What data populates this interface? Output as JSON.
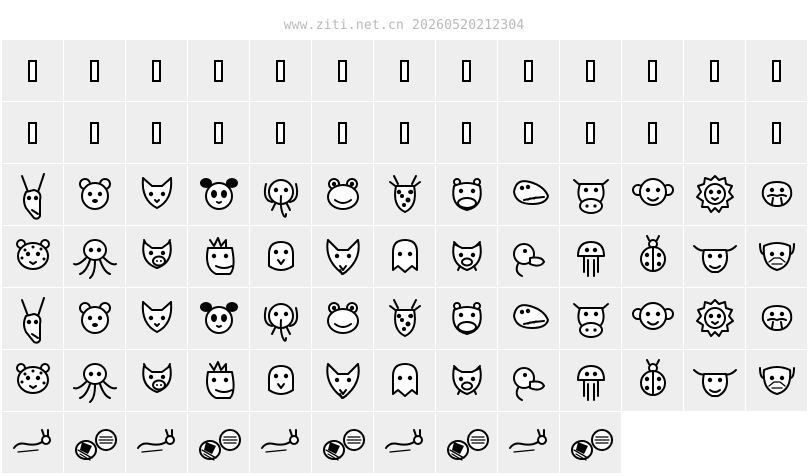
{
  "watermark": "www.ziti.net.cn 20260520212304",
  "rows": [
    [
      "tofu",
      "tofu",
      "tofu",
      "tofu",
      "tofu",
      "tofu",
      "tofu",
      "tofu",
      "tofu",
      "tofu",
      "tofu",
      "tofu",
      "tofu"
    ],
    [
      "tofu",
      "tofu",
      "tofu",
      "tofu",
      "tofu",
      "tofu",
      "tofu",
      "tofu",
      "tofu",
      "tofu",
      "tofu",
      "tofu",
      "tofu"
    ],
    [
      "donkey",
      "bear",
      "cat",
      "panda",
      "elephant",
      "frog",
      "giraffe",
      "hippo",
      "crocodile",
      "cow",
      "monkey",
      "lion",
      "walrus"
    ],
    [
      "leopard",
      "octopus",
      "pig",
      "horse",
      "bird",
      "fox",
      "ghost",
      "boar",
      "duck",
      "mushroom",
      "ladybug",
      "bull",
      "dog"
    ],
    [
      "donkey",
      "bear",
      "cat",
      "panda",
      "elephant",
      "frog",
      "giraffe",
      "hippo",
      "crocodile",
      "cow",
      "monkey",
      "lion",
      "walrus"
    ],
    [
      "leopard",
      "octopus",
      "pig",
      "horse",
      "bird",
      "fox",
      "ghost",
      "boar",
      "duck",
      "mushroom",
      "ladybug",
      "bull",
      "dog"
    ],
    [
      "snail",
      "badge",
      "snail",
      "badge",
      "snail",
      "badge",
      "snail",
      "badge",
      "snail",
      "badge",
      "empty",
      "empty",
      "empty"
    ]
  ]
}
